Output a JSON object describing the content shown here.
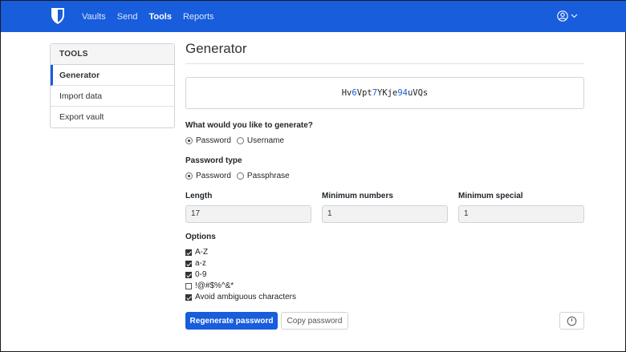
{
  "nav": {
    "items": [
      {
        "label": "Vaults",
        "active": false
      },
      {
        "label": "Send",
        "active": false
      },
      {
        "label": "Tools",
        "active": true
      },
      {
        "label": "Reports",
        "active": false
      }
    ],
    "logo_icon": "bitwarden-shield-icon",
    "account_icon": "user-circle-icon",
    "brand_color": "#175ddc"
  },
  "sidebar": {
    "header": "TOOLS",
    "items": [
      {
        "label": "Generator",
        "active": true
      },
      {
        "label": "Import data",
        "active": false
      },
      {
        "label": "Export vault",
        "active": false
      }
    ]
  },
  "main": {
    "title": "Generator",
    "password_segments": [
      {
        "text": "Hv",
        "num": false
      },
      {
        "text": "6",
        "num": true
      },
      {
        "text": "Vpt",
        "num": false
      },
      {
        "text": "7",
        "num": true
      },
      {
        "text": "YKje",
        "num": false
      },
      {
        "text": "94",
        "num": true
      },
      {
        "text": "uVQs",
        "num": false
      }
    ],
    "generate_question": "What would you like to generate?",
    "generate_options": [
      {
        "label": "Password",
        "checked": true
      },
      {
        "label": "Username",
        "checked": false
      }
    ],
    "password_type_label": "Password type",
    "password_type_options": [
      {
        "label": "Password",
        "checked": true
      },
      {
        "label": "Passphrase",
        "checked": false
      }
    ],
    "length_label": "Length",
    "length_value": "17",
    "min_numbers_label": "Minimum numbers",
    "min_numbers_value": "1",
    "min_special_label": "Minimum special",
    "min_special_value": "1",
    "options_label": "Options",
    "options": [
      {
        "label": "A-Z",
        "checked": true
      },
      {
        "label": "a-z",
        "checked": true
      },
      {
        "label": "0-9",
        "checked": true
      },
      {
        "label": "!@#$%^&*",
        "checked": false
      },
      {
        "label": "Avoid ambiguous characters",
        "checked": true
      }
    ],
    "regenerate_label": "Regenerate password",
    "copy_label": "Copy password",
    "history_icon": "history-clock-icon"
  }
}
